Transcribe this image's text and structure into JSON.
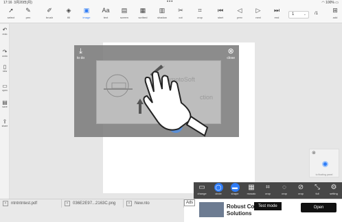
{
  "status": {
    "time": "17:16",
    "date": "3月20日(月)",
    "battery": "100%"
  },
  "toolbar": {
    "tools": [
      {
        "label": "select",
        "icon": "cursor-icon"
      },
      {
        "label": "pen",
        "icon": "pen-icon"
      },
      {
        "label": "brush",
        "icon": "brush-icon"
      },
      {
        "label": "fill",
        "icon": "fill-icon"
      },
      {
        "label": "image",
        "icon": "image-icon",
        "active": true
      },
      {
        "label": "text",
        "icon": "text-icon"
      },
      {
        "label": "screen",
        "icon": "screen-icon"
      },
      {
        "label": "scribed",
        "icon": "scribed-icon"
      },
      {
        "label": "shadow",
        "icon": "shadow-icon"
      },
      {
        "label": "cut",
        "icon": "cut-icon"
      },
      {
        "label": "crop",
        "icon": "crop-icon"
      },
      {
        "label": "start",
        "icon": "first-page-icon"
      },
      {
        "label": "prev",
        "icon": "prev-page-icon"
      },
      {
        "label": "next",
        "icon": "next-page-icon"
      },
      {
        "label": "end",
        "icon": "last-page-icon"
      }
    ],
    "page_current": "1",
    "page_total": "/1",
    "add_label": "add"
  },
  "sidebar": [
    {
      "label": "redo",
      "icon": "undo-icon"
    },
    {
      "label": "undo",
      "icon": "redo-icon"
    },
    {
      "label": "new",
      "icon": "new-doc-icon"
    },
    {
      "label": "open",
      "icon": "open-folder-icon"
    },
    {
      "label": "save",
      "icon": "save-icon"
    },
    {
      "label": "share",
      "icon": "share-icon"
    }
  ],
  "overlay": {
    "todo_label": "to do",
    "close_label": "close",
    "slide_text_1": "YamamotoSoft",
    "slide_text_2": "ction",
    "slide_text_3": "S"
  },
  "thumb": {
    "caption": "to floating panel"
  },
  "bottom_tools": [
    {
      "label": "change",
      "icon": "folder-icon"
    },
    {
      "label": "circle",
      "icon": "circle-icon",
      "active": true
    },
    {
      "label": "shape",
      "icon": "shape-icon",
      "active": true
    },
    {
      "label": "mosaic",
      "icon": "mosaic-icon"
    },
    {
      "label": "crop",
      "icon": "crop-icon"
    },
    {
      "label": "crop",
      "icon": "circle-crop-icon"
    },
    {
      "label": "crop",
      "icon": "slash-crop-icon"
    },
    {
      "label": "full",
      "icon": "expand-icon"
    },
    {
      "label": "setting",
      "icon": "gear-icon"
    }
  ],
  "tabs": [
    {
      "label": "ntntntntest.pdf"
    },
    {
      "label": "036E2E97...2163C.png"
    },
    {
      "label": "New.nto"
    }
  ],
  "ad": {
    "badge": "Ads",
    "headline": "Robust Con... Solutions",
    "test_mode": "Test mode",
    "open_label": "Open"
  },
  "colors": {
    "accent": "#2f7cf6",
    "dark_panel": "#474747"
  }
}
